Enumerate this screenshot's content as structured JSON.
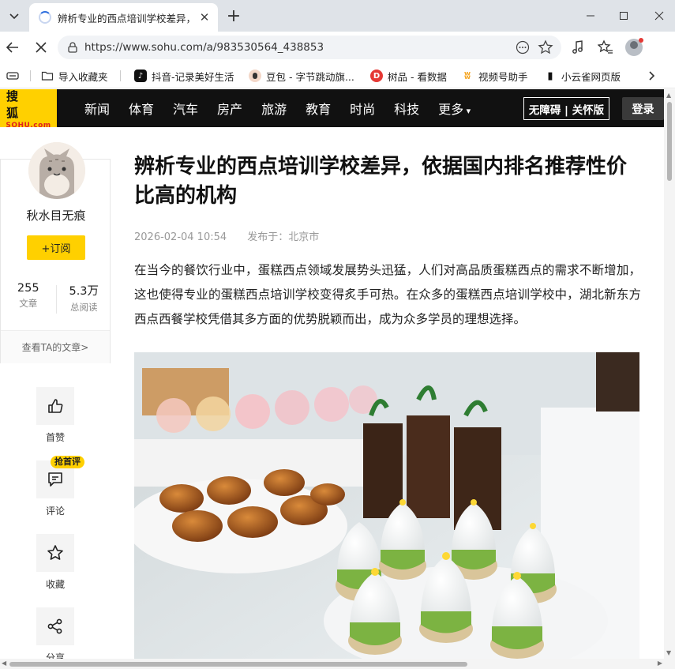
{
  "browser": {
    "tab_title": "辨析专业的西点培训学校差异，依",
    "url": "https://www.sohu.com/a/983530564_438853",
    "bookmarks": [
      {
        "label": "导入收藏夹",
        "icon": "folder-icon"
      },
      {
        "label": "抖音-记录美好生活",
        "icon": "douyin-icon",
        "color": "#111111"
      },
      {
        "label": "豆包 - 字节跳动旗...",
        "icon": "doubao-icon"
      },
      {
        "label": "树品 - 看数据",
        "icon": "shupin-icon",
        "color": "#e53935"
      },
      {
        "label": "视频号助手",
        "icon": "shipinhao-icon",
        "color": "#f5a623"
      },
      {
        "label": "小云雀网页版",
        "icon": "xiaoyunque-icon",
        "color": "#111111"
      }
    ]
  },
  "site": {
    "logo_cn": "搜 狐",
    "logo_en": "SOHU.com",
    "nav": [
      "新闻",
      "体育",
      "汽车",
      "房产",
      "旅游",
      "教育",
      "时尚",
      "科技",
      "更多"
    ],
    "accessibility": "无障碍 | 关怀版",
    "login": "登录",
    "brand_color": "#ffd000"
  },
  "author": {
    "name": "秋水目无痕",
    "subscribe": "+订阅",
    "articles_count": "255",
    "articles_label": "文章",
    "reads_count": "5.3万",
    "reads_label": "总阅读",
    "view_articles": "查看TA的文章>"
  },
  "actions": [
    {
      "label": "首赞",
      "icon": "thumbs-up-icon"
    },
    {
      "label": "评论",
      "icon": "comment-icon",
      "badge": "抢首评"
    },
    {
      "label": "收藏",
      "icon": "star-icon"
    },
    {
      "label": "分享",
      "icon": "share-icon"
    }
  ],
  "article": {
    "title": "辨析专业的西点培训学校差异，依据国内排名推荐性价比高的机构",
    "date": "2026-02-04 10:54",
    "location": "发布于：北京市",
    "paragraph": "在当今的餐饮行业中，蛋糕西点领域发展势头迅猛，人们对高品质蛋糕西点的需求不断增加，这也使得专业的蛋糕西点培训学校变得炙手可热。在众多的蛋糕西点培训学校中，湖北新东方西点西餐学校凭借其多方面的优势脱颖而出，成为众多学员的理想选择。"
  }
}
